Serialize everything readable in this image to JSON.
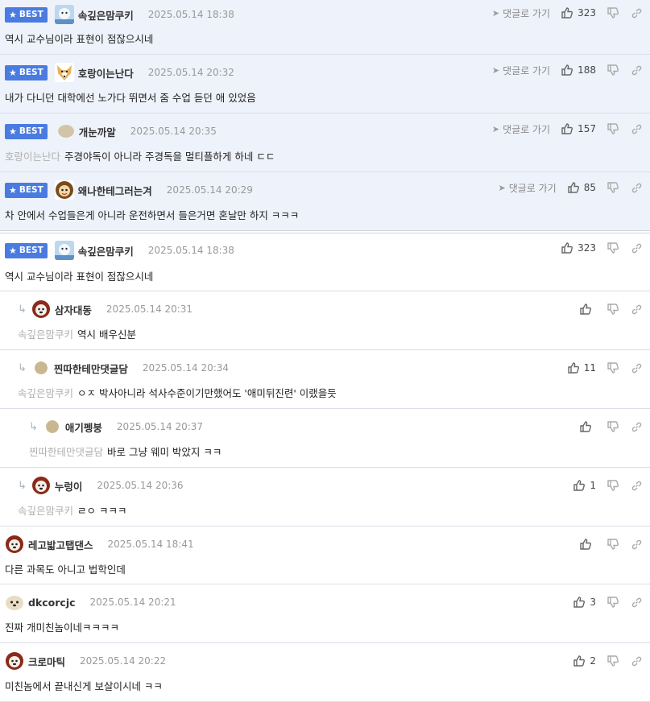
{
  "ui": {
    "goto_label": "댓글로 가기",
    "best_label": "BEST"
  },
  "best_comments": [
    {
      "nick": "속깊은맘쿠키",
      "time": "2025.05.14 18:38",
      "likes": "323",
      "text": "역시 교수님이라 표현이 점잖으시네",
      "mention": ""
    },
    {
      "nick": "호랑이는난다",
      "time": "2025.05.14 20:32",
      "likes": "188",
      "text": "내가 다니던 대학에선 노가다 뛰면서 줌 수업 듣던 애 있었음",
      "mention": ""
    },
    {
      "nick": "개눈까알",
      "time": "2025.05.14 20:35",
      "likes": "157",
      "text": "주경야독이 아니라 주경독을 멀티플하게 하네 ㄷㄷ",
      "mention": "호랑이는난다"
    },
    {
      "nick": "왜나한테그러는겨",
      "time": "2025.05.14 20:29",
      "likes": "85",
      "text": "차 안에서 수업들은게 아니라 운전하면서 들은거면 혼날만 하지 ㅋㅋㅋ",
      "mention": ""
    }
  ],
  "comments": [
    {
      "best": true,
      "nick": "속깊은맘쿠키",
      "time": "2025.05.14 18:38",
      "likes": "323",
      "mention": "",
      "text": "역시 교수님이라 표현이 점잖으시네"
    },
    {
      "depth": 1,
      "nick": "삼자대동",
      "time": "2025.05.14 20:31",
      "likes": "",
      "mention": "속깊은맘쿠키",
      "text": "역시 배우신분"
    },
    {
      "depth": 1,
      "nick": "찐따한테만댓글담",
      "time": "2025.05.14 20:34",
      "likes": "11",
      "mention": "속깊은맘쿠키",
      "text": "ㅇㅈ 박사아니라 석사수준이기만했어도 '애미뒤진련' 이랬을듯"
    },
    {
      "depth": 2,
      "nick": "애기펭붕",
      "time": "2025.05.14 20:37",
      "likes": "",
      "mention": "찐따한테만댓글담",
      "text": "바로 그냥 웨미 박았지 ㅋㅋ"
    },
    {
      "depth": 1,
      "nick": "누렁이",
      "time": "2025.05.14 20:36",
      "likes": "1",
      "mention": "속깊은맘쿠키",
      "text": "ㄹㅇ ㅋㅋㅋ"
    },
    {
      "depth": 0,
      "nick": "레고밟고탭댄스",
      "time": "2025.05.14 18:41",
      "likes": "",
      "mention": "",
      "text": "다른 과목도 아니고 법학인데"
    },
    {
      "depth": 0,
      "nick": "dkcorcjc",
      "time": "2025.05.14 20:21",
      "likes": "3",
      "mention": "",
      "text": "진짜 개미친놈이네ㅋㅋㅋㅋ"
    },
    {
      "depth": 0,
      "nick": "크로마틱",
      "time": "2025.05.14 20:22",
      "likes": "2",
      "mention": "",
      "text": "미친놈에서 끝내신게 보살이시네 ㅋㅋ"
    }
  ]
}
